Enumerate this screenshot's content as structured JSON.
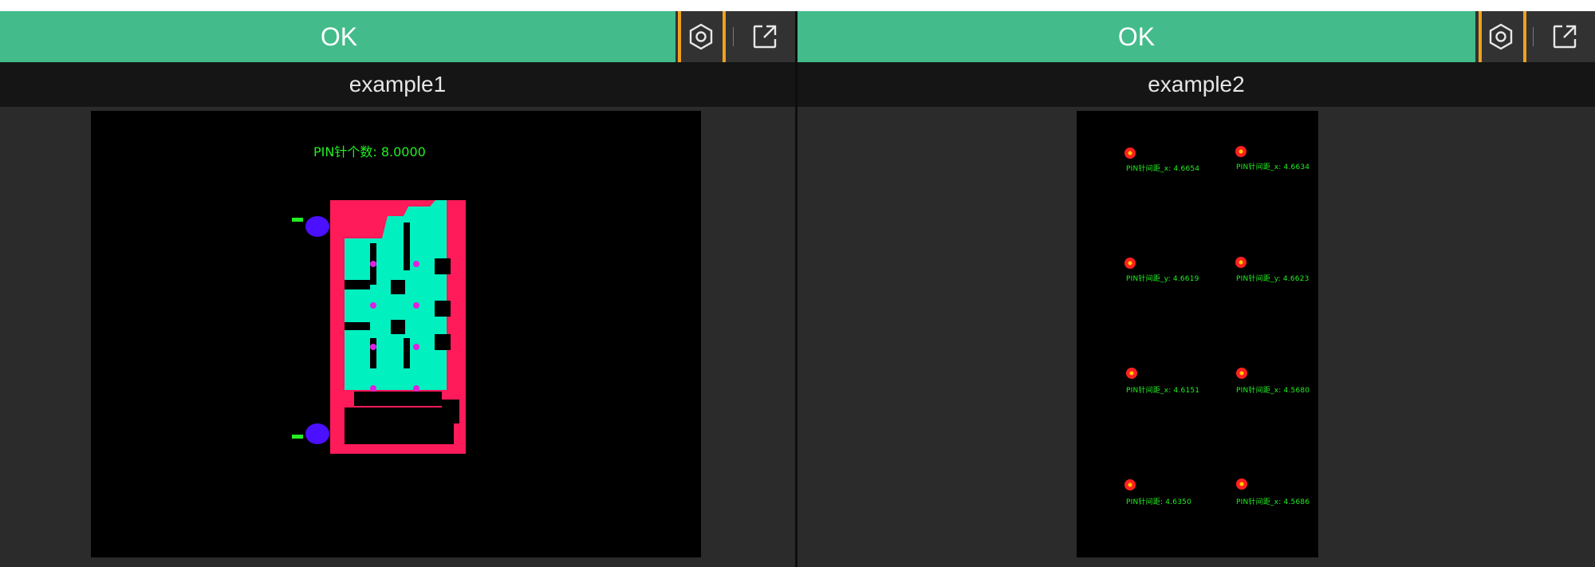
{
  "panels": [
    {
      "status": "OK",
      "title": "example1",
      "overlay_text": "PIN针个数: 8.0000",
      "icons": {
        "settings": "settings-hexagon-icon",
        "popout": "open-external-icon"
      }
    },
    {
      "status": "OK",
      "title": "example2",
      "labels": [
        "PIN针间距_x: 4.6654",
        "PIN针间距_x: 4.6634",
        "PIN针间距_y: 4.6619",
        "PIN针间距_y: 4.6623",
        "PIN针间距_x: 4.6151",
        "PIN针间距_x: 4.5680",
        "PIN针间距: 4.6350",
        "PIN针间距_x: 4.5686"
      ],
      "icons": {
        "settings": "settings-hexagon-icon",
        "popout": "open-external-icon"
      }
    }
  ],
  "colors": {
    "status_ok": "#43bb8b",
    "highlight": "#f0a020",
    "overlay_text": "#22ee22",
    "part_body": "#ff1a5a",
    "part_region": "#00f0c0",
    "part_pin": "#4a10ff",
    "point_marker": "#ff2020"
  }
}
